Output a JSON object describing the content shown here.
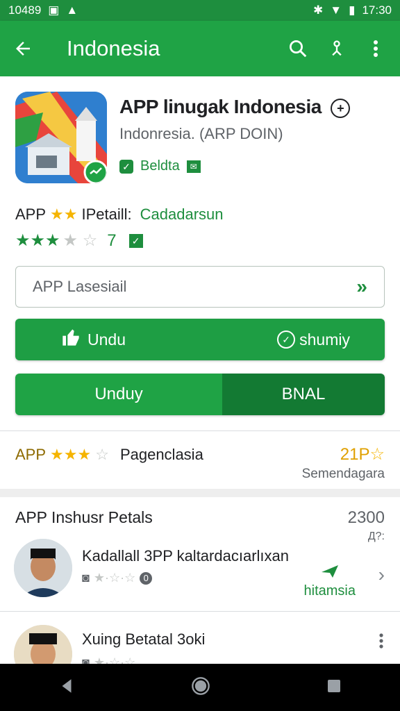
{
  "status": {
    "time_left": "10489",
    "time_right": "17:30"
  },
  "appbar": {
    "title": "Indonesia"
  },
  "app": {
    "title": "APP linugak Indonesia",
    "subtitle": "Indonresia. (ARP  DOIN)",
    "badge": "Beldta"
  },
  "rating": {
    "app": "APP",
    "detail": "IPetaill:",
    "category": "Cadadarsun",
    "count": "7"
  },
  "input": {
    "placeholder": "APP Lasesiail"
  },
  "buttons": {
    "download": "Undu",
    "secondary": "shumiy",
    "split_left": "Unduy",
    "split_right": "BNAL"
  },
  "summary": {
    "app": "APP",
    "label": "Pagenclasia",
    "count": "21P",
    "sub": "Semendagara"
  },
  "reviews": {
    "title": "APP Inshusr Petals",
    "count": "2300",
    "count_sub": "Д?:",
    "items": [
      {
        "name": "Kadallall 3PP kaltardacıarlıxan",
        "meta": "0",
        "tag": "hitamsia"
      },
      {
        "name": "Xuing Betatal 3oki",
        "meta": ""
      }
    ]
  },
  "colors": {
    "primary": "#1fa345",
    "dark": "#137a33",
    "accent": "#f5b400"
  }
}
